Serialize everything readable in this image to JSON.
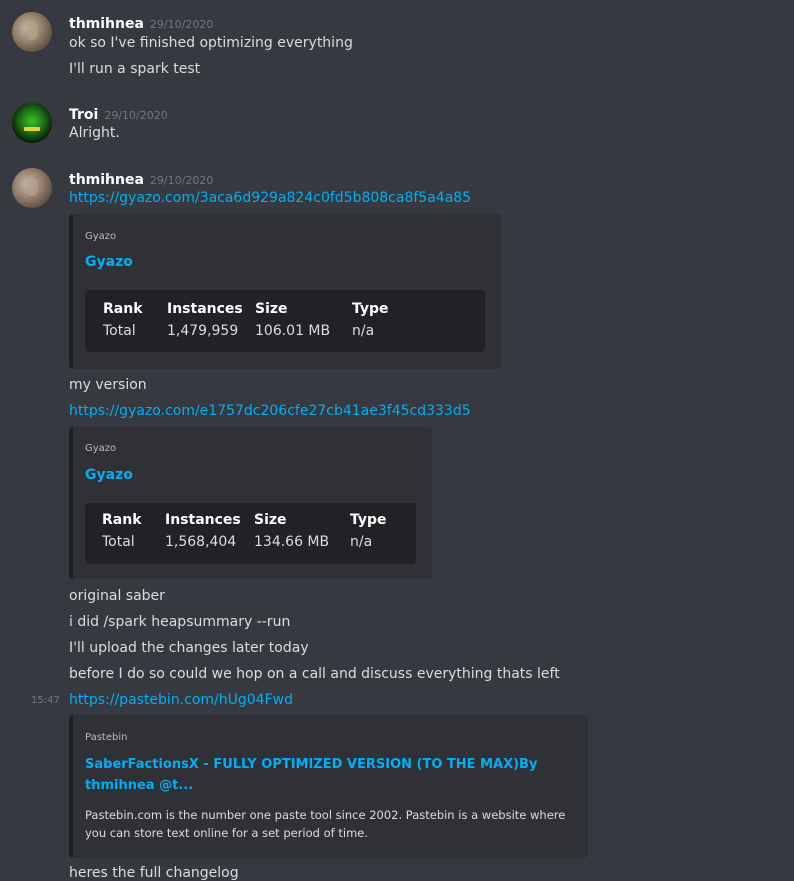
{
  "messages": [
    {
      "username": "thmihnea",
      "timestamp": "29/10/2020",
      "lines": [
        "ok so I've finished optimizing everything",
        "I'll run a spark test"
      ]
    },
    {
      "username": "Troi",
      "timestamp": "29/10/2020",
      "lines": [
        "Alright."
      ]
    },
    {
      "username": "thmihnea",
      "timestamp": "29/10/2020",
      "link1": "https://gyazo.com/3aca6d929a824c0fd5b808ca8f5a4a85",
      "embed1": {
        "provider": "Gyazo",
        "title": "Gyazo",
        "headers": [
          "Rank",
          "Instances",
          "Size",
          "Type"
        ],
        "values": [
          "Total",
          "1,479,959",
          "106.01 MB",
          "n/a"
        ]
      },
      "line_my_version": "my version",
      "link2": "https://gyazo.com/e1757dc206cfe27cb41ae3f45cd333d5",
      "embed2": {
        "provider": "Gyazo",
        "title": "Gyazo",
        "headers": [
          "Rank",
          "Instances",
          "Size",
          "Type"
        ],
        "values": [
          "Total",
          "1,568,404",
          "134.66 MB",
          "n/a"
        ]
      },
      "followups": [
        "original saber",
        "i did /spark heapsummary --run",
        "I'll upload the changes later today",
        "before I do so could we hop on a call and discuss everything thats left"
      ],
      "hover_time": "15:47",
      "link3": "https://pastebin.com/hUg04Fwd",
      "embed3": {
        "provider": "Pastebin",
        "title_line1": "SaberFactionsX - FULLY OPTIMIZED VERSION (TO THE MAX)By",
        "title_line2": "thmihnea @t...",
        "desc_line1": "Pastebin.com is the number one paste tool since 2002. Pastebin is a website where",
        "desc_line2": "you can store text online for a set period of time."
      },
      "last_line": "heres the full changelog"
    }
  ]
}
